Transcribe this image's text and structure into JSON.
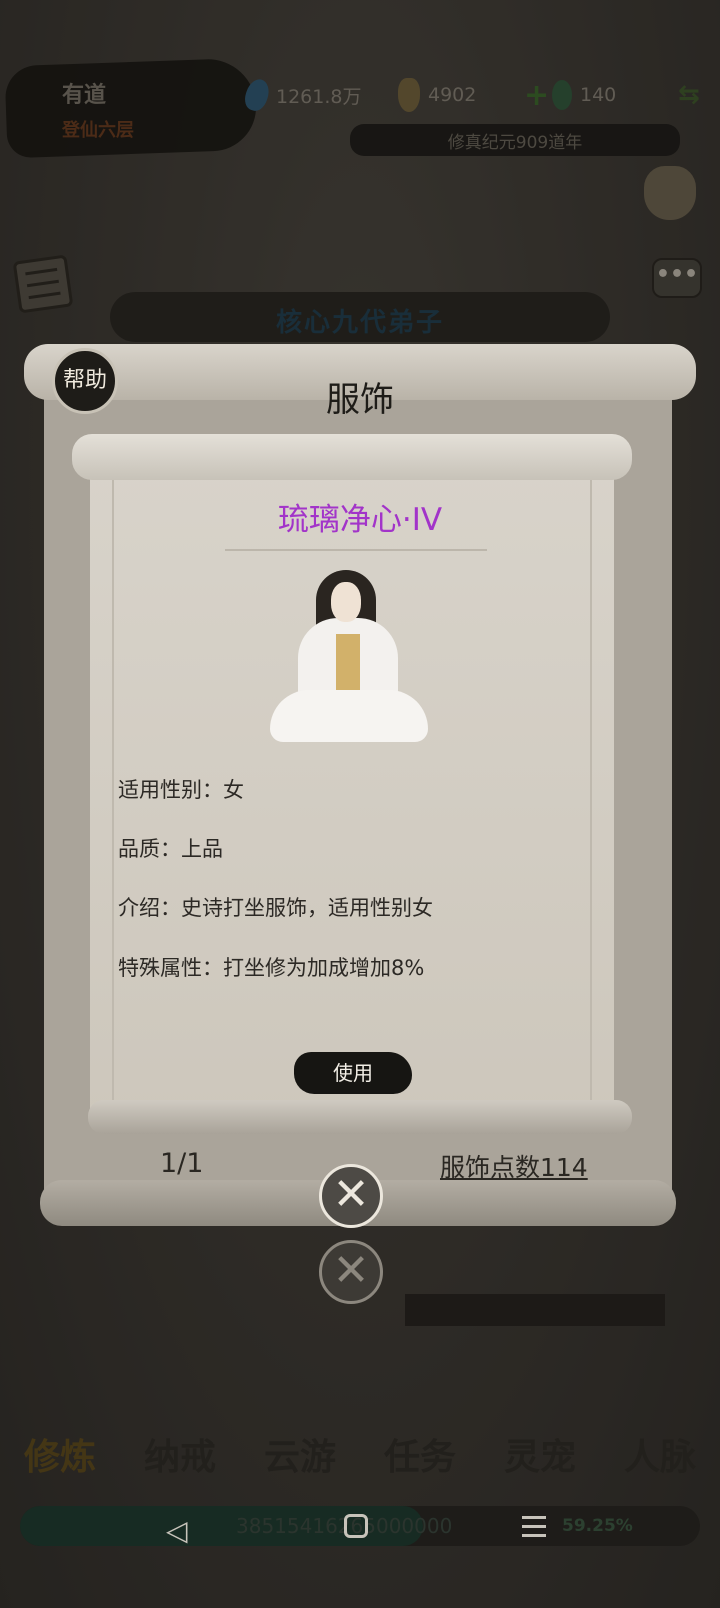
{
  "header": {
    "player_name": "有道",
    "realm": "登仙六层",
    "spirit_stones": "1261.8万",
    "gourd_count": "4902",
    "jade_count": "140",
    "era": "修真纪元909道年",
    "add_symbol": "+",
    "swap_symbol": "⇆"
  },
  "section_title": "核心九代弟子",
  "chat_icon": "•••",
  "dialog": {
    "help_label": "帮助",
    "title": "服饰",
    "item_name": "琉璃净心·IV",
    "attributes": [
      "适用性别：女",
      "品质：上品",
      "介绍：史诗打坐服饰，适用性别女",
      "特殊属性：打坐修为加成增加8%"
    ],
    "use_button": "使用",
    "page_indicator": "1/1",
    "costume_points": "服饰点数114",
    "close_symbol": "✕"
  },
  "bottom_nav": [
    "修炼",
    "纳戒",
    "云游",
    "任务",
    "灵宠",
    "人脉"
  ],
  "progress": {
    "text": "38515416265000000",
    "percent": "59.25%",
    "fraction": 0.5925
  },
  "system_nav": {
    "back": "◁"
  },
  "colors": {
    "item_name": "#a234c9",
    "parchment": "#d8d3ca",
    "ink": "#161512"
  }
}
